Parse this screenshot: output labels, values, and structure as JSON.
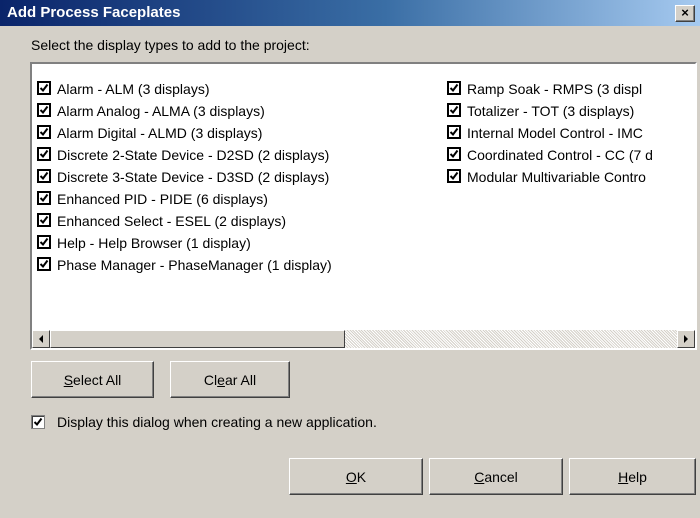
{
  "window": {
    "title": "Add Process Faceplates",
    "close_glyph": "×"
  },
  "prompt": "Select the display types to add to the project:",
  "list": {
    "column1": [
      {
        "label": "Alarm - ALM (3 displays)",
        "checked": true
      },
      {
        "label": "Alarm Analog - ALMA (3 displays)",
        "checked": true
      },
      {
        "label": "Alarm Digital - ALMD (3 displays)",
        "checked": true
      },
      {
        "label": "Discrete 2-State Device - D2SD (2 displays)",
        "checked": true
      },
      {
        "label": "Discrete 3-State Device - D3SD (2 displays)",
        "checked": true
      },
      {
        "label": "Enhanced PID - PIDE (6 displays)",
        "checked": true
      },
      {
        "label": "Enhanced Select - ESEL (2 displays)",
        "checked": true
      },
      {
        "label": "Help - Help Browser (1 display)",
        "checked": true
      },
      {
        "label": "Phase Manager - PhaseManager (1 display)",
        "checked": true
      }
    ],
    "column2": [
      {
        "label": "Ramp Soak - RMPS (3 displ",
        "checked": true
      },
      {
        "label": "Totalizer - TOT (3 displays)",
        "checked": true
      },
      {
        "label": "Internal Model Control - IMC",
        "checked": true
      },
      {
        "label": "Coordinated Control - CC (7 d",
        "checked": true
      },
      {
        "label": "Modular Multivariable Contro",
        "checked": true
      }
    ],
    "scroll_fraction": 0.47
  },
  "buttons": {
    "select_all": {
      "pre": "",
      "mnemonic": "S",
      "post": "elect All"
    },
    "clear_all": {
      "pre": "Cl",
      "mnemonic": "e",
      "post": "ar All"
    },
    "ok": {
      "pre": "",
      "mnemonic": "O",
      "post": "K"
    },
    "cancel": {
      "pre": "",
      "mnemonic": "C",
      "post": "ancel"
    },
    "help": {
      "pre": "",
      "mnemonic": "H",
      "post": "elp"
    }
  },
  "display_on_create": {
    "label": "Display this dialog when creating a new application.",
    "checked": true
  }
}
